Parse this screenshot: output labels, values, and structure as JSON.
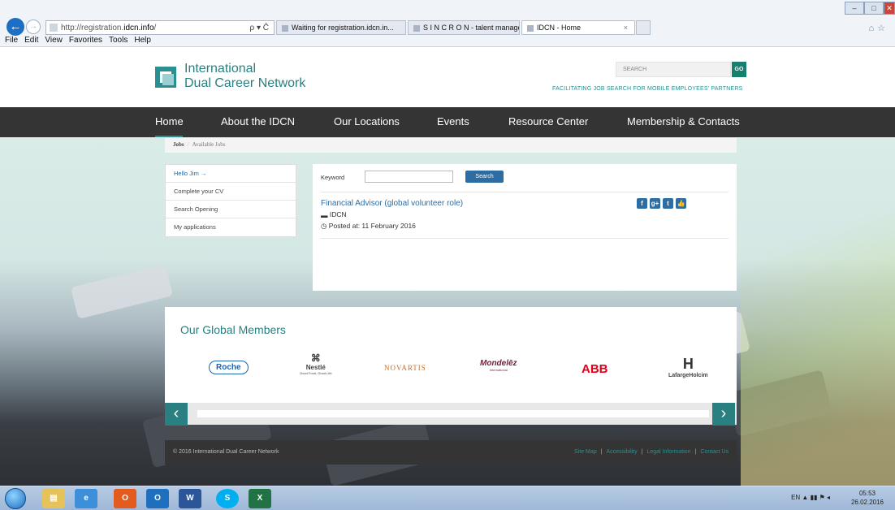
{
  "browser": {
    "address_url_prefix": "http://registration.",
    "address_url_domain": "idcn.info",
    "address_url_suffix": "/",
    "address_tools": "ρ ▾ Ĉ",
    "tabs": [
      {
        "label": "Waiting for registration.idcn.in...",
        "active": false
      },
      {
        "label": "S I N C R O N - talent manage...",
        "active": false
      },
      {
        "label": "IDCN - Home",
        "active": true
      }
    ],
    "tab_close": "×",
    "menu": [
      "File",
      "Edit",
      "View",
      "Favorites",
      "Tools",
      "Help"
    ]
  },
  "header": {
    "logo_line1": "International",
    "logo_line2": "Dual Career Network",
    "search_placeholder": "SEARCH",
    "go_label": "GO",
    "tagline": "FACILITATING JOB SEARCH FOR MOBILE EMPLOYEES' PARTNERS"
  },
  "nav": {
    "items": [
      "Home",
      "About the IDCN",
      "Our Locations",
      "Events",
      "Resource Center",
      "Membership & Contacts"
    ]
  },
  "breadcrumb": {
    "jobs": "Jobs",
    "separator": "/",
    "available": "Available Jobs"
  },
  "sidebar": {
    "items": [
      "Hello Jim →",
      "Complete your CV",
      "Search Opening",
      "My applications"
    ]
  },
  "search": {
    "keyword_label": "Keyword",
    "keyword_value": "",
    "button_label": "Search"
  },
  "job": {
    "title": "Financial Advisor (global volunteer role)",
    "company": "IDCN",
    "posted": "Posted at: 11 February 2016",
    "social_icons": [
      "facebook-icon",
      "google-plus-icon",
      "twitter-icon",
      "like-icon"
    ]
  },
  "members": {
    "title": "Our Global Members",
    "logos": [
      "Roche",
      "Nestlé",
      "NOVARTIS",
      "Mondelēz",
      "ABB",
      "LafargeHolcim"
    ],
    "logo_sublabels": {
      "nestle": "Good Food, Good Life",
      "mondelez": "International"
    },
    "prev": "‹",
    "next": "›"
  },
  "footer": {
    "copyright": "© 2016 International Dual Career Network",
    "links": [
      "Site Map",
      "Accessibility",
      "Legal Information",
      "Contact Us"
    ]
  },
  "taskbar": {
    "apps": [
      "explorer",
      "ie",
      "outlook-o",
      "outlook",
      "word",
      "skype",
      "excel"
    ],
    "lang": "EN",
    "time": "05:53",
    "date": "26.02.2016"
  },
  "colors": {
    "accent": "#2a8f90",
    "nav_bg": "#343434",
    "link": "#2e6da4"
  }
}
